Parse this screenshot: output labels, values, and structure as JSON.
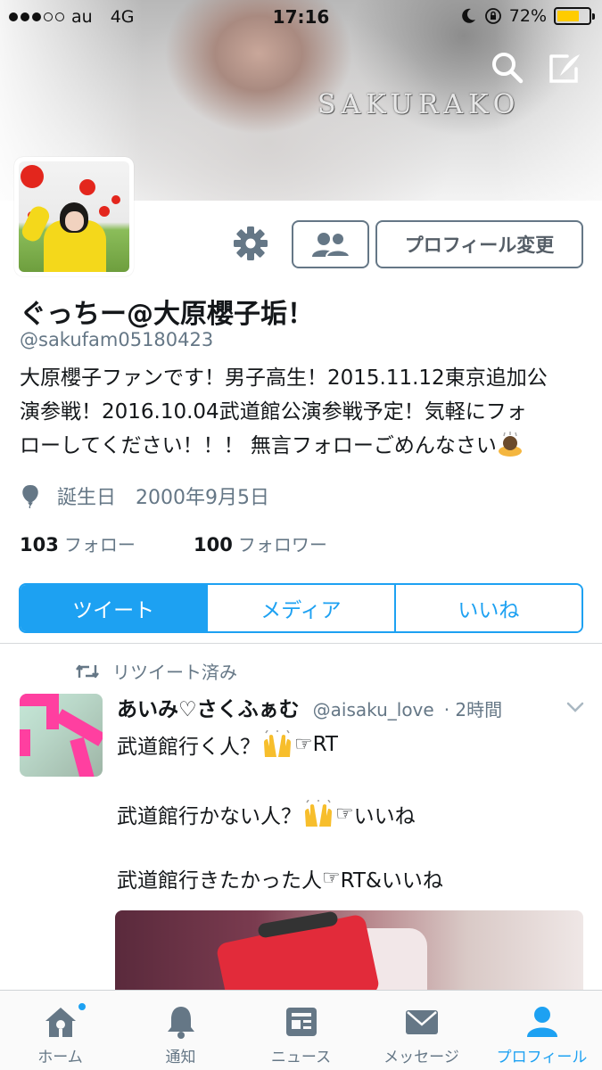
{
  "status_bar": {
    "carrier": "au",
    "network": "4G",
    "time": "17:16",
    "battery": "72%",
    "battery_level": 0.72,
    "signal_bars_filled": 3,
    "signal_bars_total": 5
  },
  "header": {
    "watermark": "SAKURAKO"
  },
  "profile": {
    "name": "ぐっちー@大原櫻子垢！",
    "handle": "@sakufam05180423",
    "bio_line1": "大原櫻子ファンです！男子高生！2015.11.12東京追加公",
    "bio_line2": "演参戦！2016.10.04武道館公演参戦予定！気軽にフォ",
    "bio_line3": "ローしてください！！！ 無言フォローごめんなさい",
    "birthday_label": "誕生日",
    "birthday_value": "2000年9月5日",
    "following_count": "103",
    "following_label": "フォロー",
    "followers_count": "100",
    "followers_label": "フォロワー",
    "edit_button": "プロフィール変更"
  },
  "tabs": [
    {
      "label": "ツイート",
      "active": true
    },
    {
      "label": "メディア",
      "active": false
    },
    {
      "label": "いいね",
      "active": false
    }
  ],
  "tweet": {
    "retweet_label": "リツイート済み",
    "author": "あいみ♡さくふぁむ",
    "handle": "@aisaku_love",
    "time": "· 2時間",
    "line1": "武道館行く人？",
    "line1_end": "RT",
    "line2": "武道館行かない人？",
    "line2_end": "いいね",
    "line3": "武道館行きたかった人",
    "line3_end": "RT&いいね"
  },
  "tabbar": [
    {
      "label": "ホーム",
      "icon": "home-icon"
    },
    {
      "label": "通知",
      "icon": "bell-icon"
    },
    {
      "label": "ニュース",
      "icon": "news-icon"
    },
    {
      "label": "メッセージ",
      "icon": "envelope-icon"
    },
    {
      "label": "プロフィール",
      "icon": "person-icon"
    }
  ],
  "colors": {
    "accent": "#1da1f2",
    "secondary_text": "#657786",
    "battery": "#ffcc00"
  }
}
